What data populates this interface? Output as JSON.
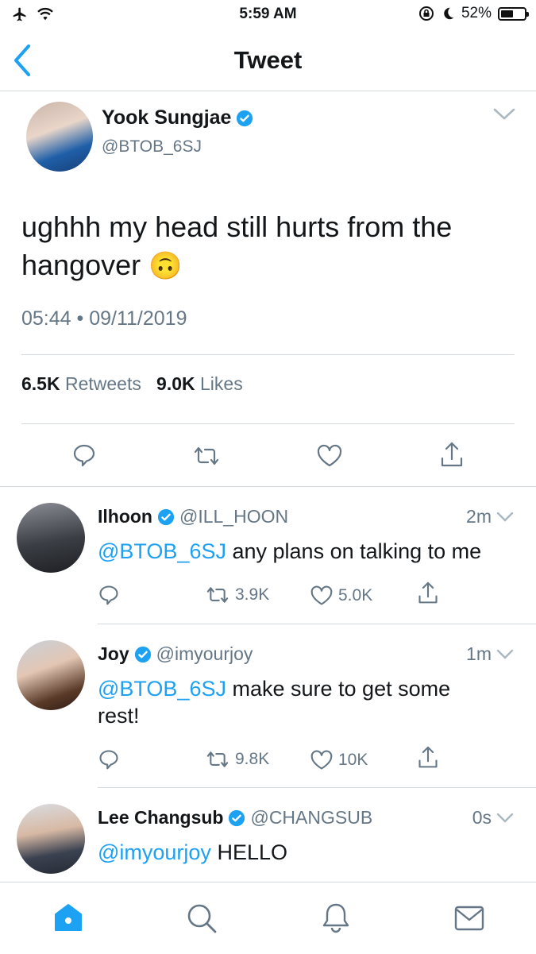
{
  "status_bar": {
    "time": "5:59 AM",
    "battery": "52%",
    "battery_level": 0.52
  },
  "nav": {
    "title": "Tweet",
    "back_icon": "chevron-left-icon"
  },
  "main_tweet": {
    "name": "Yook Sungjae",
    "handle": "@BTOB_6SJ",
    "text": "ughhh my head still hurts from the hangover",
    "emoji": "🙃",
    "timestamp": "05:44 • 09/11/2019",
    "retweets_count": "6.5K",
    "retweets_label": "Retweets",
    "likes_count": "9.0K",
    "likes_label": "Likes"
  },
  "replies": [
    {
      "name": "Ilhoon",
      "handle": "@ILL_HOON",
      "time": "2m",
      "mention": "@BTOB_6SJ",
      "text": " any plans on talking to me",
      "retweets": "3.9K",
      "likes": "5.0K"
    },
    {
      "name": "Joy",
      "handle": "@imyourjoy",
      "time": "1m",
      "mention": "@BTOB_6SJ",
      "text": " make sure to get some rest!",
      "retweets": "9.8K",
      "likes": "10K"
    },
    {
      "name": "Lee Changsub",
      "handle": "@CHANGSUB",
      "time": "0s",
      "mention": "@imyourjoy",
      "text": " HELLO"
    }
  ],
  "tab_bar": {
    "items": [
      "home-icon",
      "search-icon",
      "notifications-icon",
      "messages-icon"
    ],
    "active_color": "#1da1f2"
  },
  "colors": {
    "accent": "#1da1f2",
    "secondary_text": "#657786",
    "primary_text": "#14171a"
  }
}
